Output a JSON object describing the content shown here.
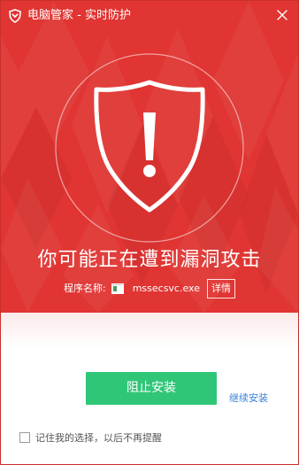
{
  "window": {
    "title": "电脑管家 - 实时防护",
    "close_symbol": "✕"
  },
  "alert": {
    "headline": "你可能正在遭到漏洞攻击",
    "program_label": "程序名称:",
    "program_name": "mssecsvc.exe",
    "details_label": "详情"
  },
  "actions": {
    "block_label": "阻止安装",
    "continue_label": "继续安装"
  },
  "remember": {
    "label": "记住我的选择，以后不再提醒",
    "checked": false
  },
  "colors": {
    "hero_red": "#e03532",
    "block_green": "#2fc678",
    "link_blue": "#3b7fd5"
  },
  "icons": {
    "app": "shield-logo-icon",
    "close": "close-icon",
    "alert": "shield-exclamation-icon",
    "file": "file-icon"
  }
}
